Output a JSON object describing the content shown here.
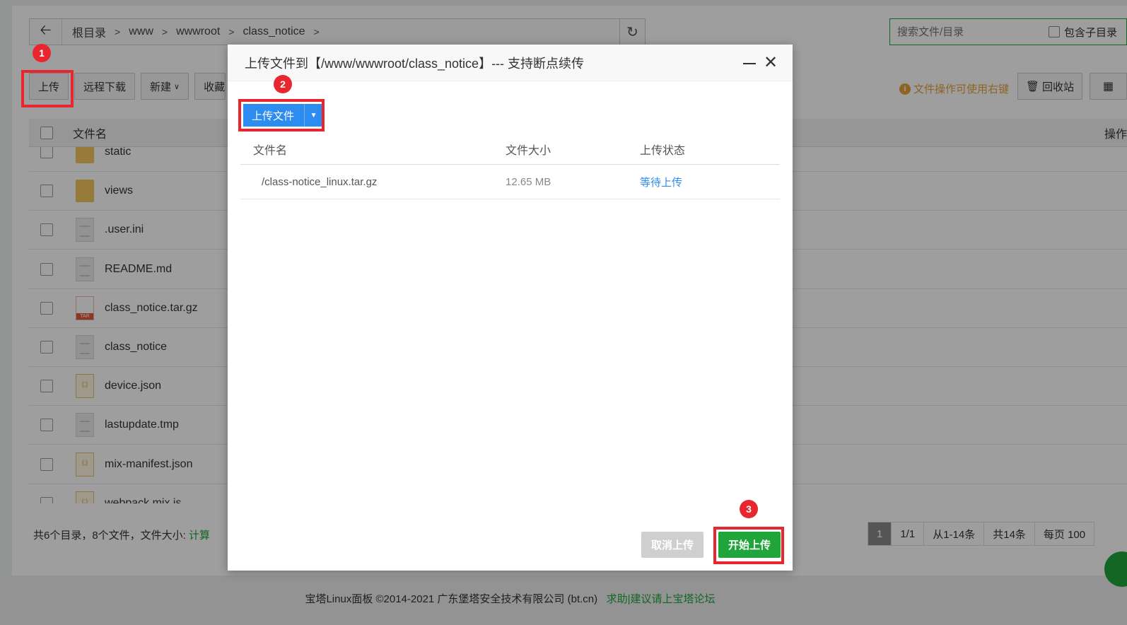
{
  "breadcrumb": {
    "items": [
      "根目录",
      "www",
      "wwwroot",
      "class_notice"
    ]
  },
  "search": {
    "placeholder": "搜索文件/目录",
    "include_subdir_label": "包含子目录"
  },
  "toolbar": {
    "upload_label": "上传",
    "remote_download_label": "远程下载",
    "new_label": "新建",
    "favorites_label": "收藏夹",
    "tip_text": "文件操作可使用右键",
    "recycle_label": "回收站"
  },
  "table": {
    "col_name": "文件名",
    "col_ops": "操作",
    "rows": [
      {
        "name": "static",
        "type": "folder"
      },
      {
        "name": "views",
        "type": "folder"
      },
      {
        "name": ".user.ini",
        "type": "doc"
      },
      {
        "name": "README.md",
        "type": "doc"
      },
      {
        "name": "class_notice.tar.gz",
        "type": "tar"
      },
      {
        "name": "class_notice",
        "type": "doc"
      },
      {
        "name": "device.json",
        "type": "json"
      },
      {
        "name": "lastupdate.tmp",
        "type": "doc"
      },
      {
        "name": "mix-manifest.json",
        "type": "json"
      },
      {
        "name": "webpack.mix.js",
        "type": "json"
      }
    ]
  },
  "footer": {
    "stats": "共6个目录，8个文件，文件大小: ",
    "calc_link": "计算",
    "pager": {
      "current": "1",
      "pages": "1/1",
      "range": "从1-14条",
      "total": "共14条",
      "per_page": "每页 100"
    },
    "copyright": "宝塔Linux面板 ©2014-2021 广东堡塔安全技术有限公司 (bt.cn)",
    "help_link": "求助|建议请上宝塔论坛"
  },
  "modal": {
    "title": "上传文件到【/www/wwwroot/class_notice】--- 支持断点续传",
    "upload_file_label": "上传文件",
    "headers": {
      "name": "文件名",
      "size": "文件大小",
      "status": "上传状态"
    },
    "files": [
      {
        "name": "/class-notice_linux.tar.gz",
        "size": "12.65 MB",
        "status": "等待上传"
      }
    ],
    "cancel_label": "取消上传",
    "start_label": "开始上传"
  },
  "markers": [
    "1",
    "2",
    "3"
  ],
  "colors": {
    "accent_green": "#20a53a",
    "accent_blue": "#2d8cf0",
    "marker_red": "#e8262d"
  }
}
